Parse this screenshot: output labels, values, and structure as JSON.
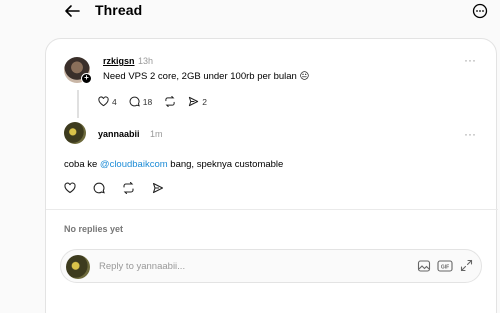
{
  "header": {
    "title": "Thread"
  },
  "original_post": {
    "username": "rzkigsn",
    "time": "13h",
    "text": "Need VPS 2 core, 2GB under 100rb per bulan 😐",
    "likes": "4",
    "replies": "18",
    "reposts": "",
    "shares": "2"
  },
  "reply_post": {
    "username": "yannaabii",
    "time": "1m",
    "text_before": "coba ke ",
    "mention": "@cloudbaikcom",
    "text_after": " bang, speknya customable"
  },
  "replies_section": {
    "empty_label": "No replies yet"
  },
  "reply_box": {
    "placeholder": "Reply to yannaabii..."
  },
  "colors": {
    "mention": "#1d8cd6",
    "background": "#fafafa",
    "card": "#ffffff"
  }
}
